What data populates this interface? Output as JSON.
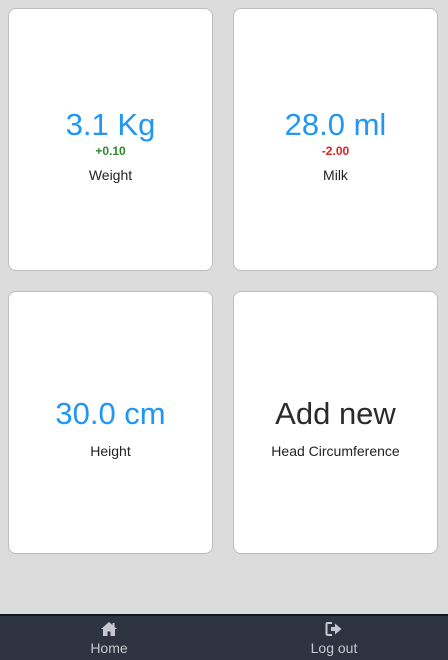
{
  "cards": [
    {
      "value": "3.1 Kg",
      "delta": "+0.10",
      "delta_color": "#2a8a2a",
      "label": "Weight"
    },
    {
      "value": "28.0 ml",
      "delta": "-2.00",
      "delta_color": "#e02020",
      "label": "Milk"
    },
    {
      "value": "30.0 cm",
      "label": "Height"
    },
    {
      "value": "Add new",
      "label": "Head Circumference"
    }
  ],
  "nav": {
    "home_label": "Home",
    "home_icon": "home-icon",
    "logout_label": "Log out",
    "logout_icon": "logout-icon"
  },
  "colors": {
    "accent": "#2196f3",
    "navbar": "#2d3340",
    "background": "#dcdcdc"
  }
}
